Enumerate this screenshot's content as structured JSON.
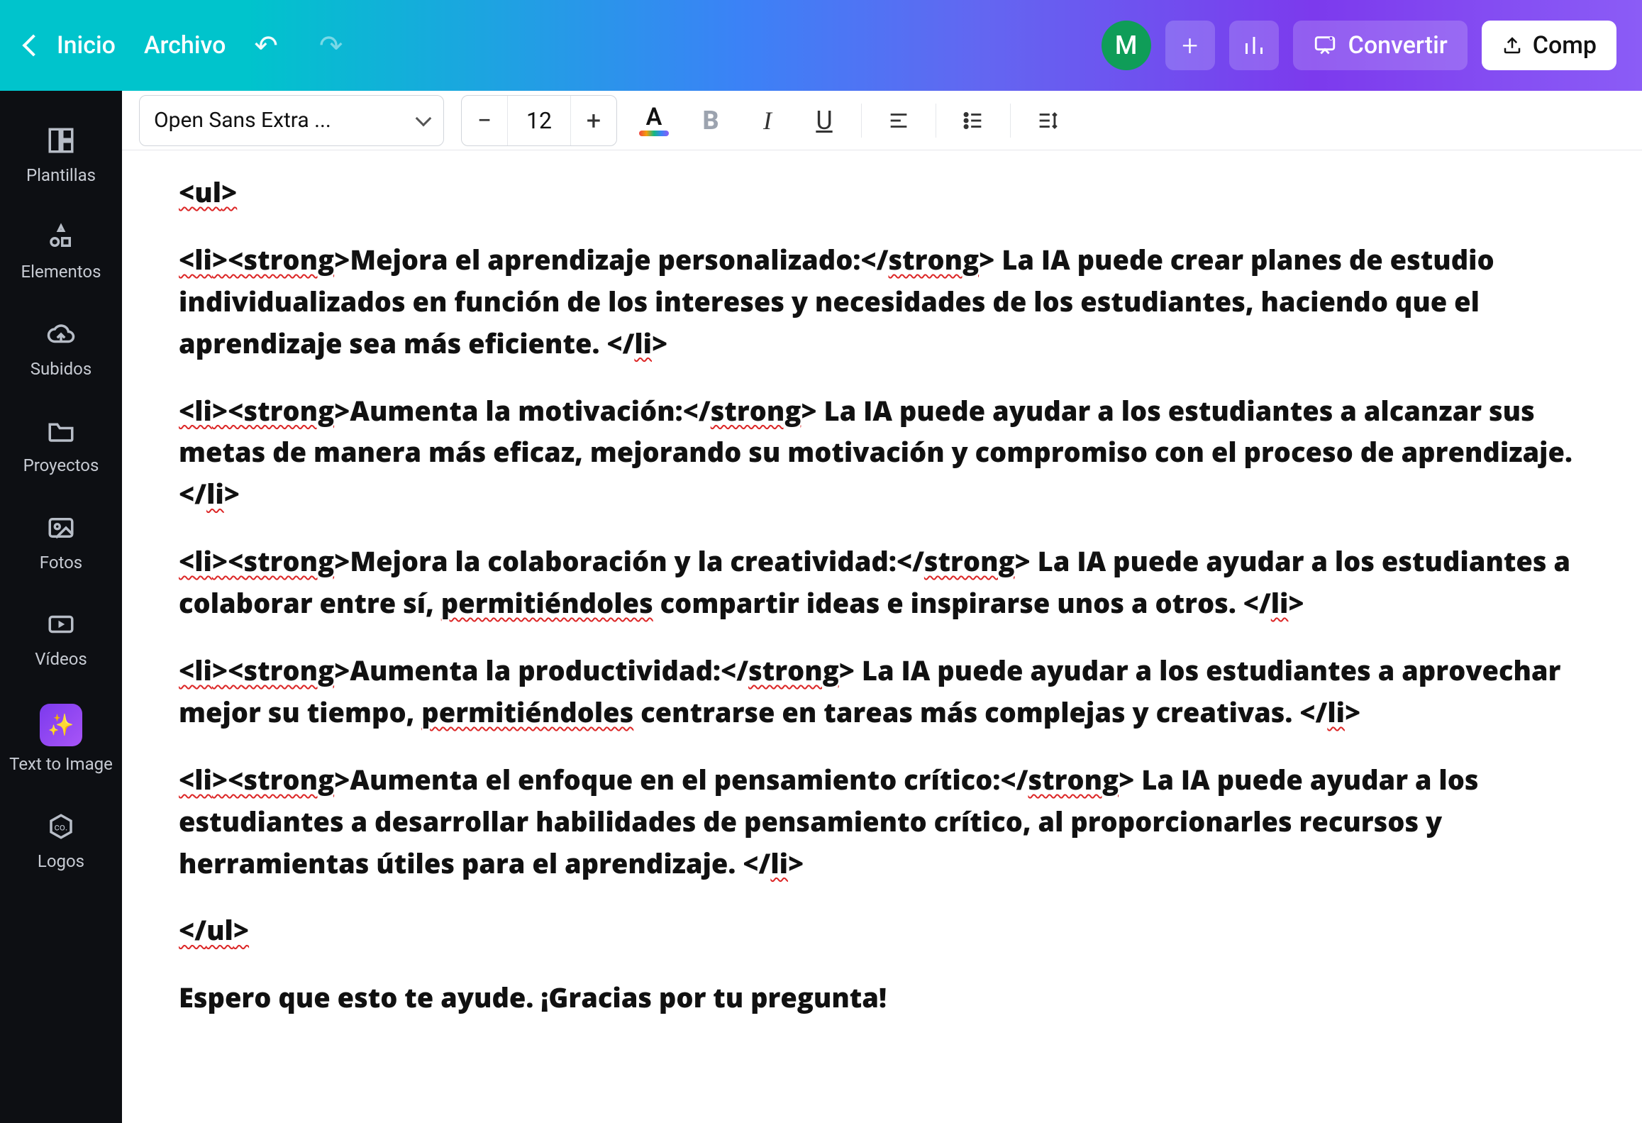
{
  "header": {
    "home_label": "Inicio",
    "file_label": "Archivo",
    "avatar_initial": "M",
    "convert_label": "Convertir",
    "share_label": "Comp"
  },
  "sidebar": {
    "items": [
      {
        "label": "Plantillas",
        "icon": "templates"
      },
      {
        "label": "Elementos",
        "icon": "elements"
      },
      {
        "label": "Subidos",
        "icon": "uploads"
      },
      {
        "label": "Proyectos",
        "icon": "projects"
      },
      {
        "label": "Fotos",
        "icon": "photos"
      },
      {
        "label": "Vídeos",
        "icon": "videos"
      },
      {
        "label": "Text to Image",
        "icon": "text-to-image"
      },
      {
        "label": "Logos",
        "icon": "logos"
      }
    ]
  },
  "toolbar": {
    "font_name": "Open Sans Extra ...",
    "font_size": "12"
  },
  "document": {
    "paragraphs": [
      {
        "runs": [
          {
            "t": "<",
            "s": true
          },
          {
            "t": "ul",
            "s": true
          },
          {
            "t": ">",
            "s": true
          }
        ]
      },
      {
        "runs": [
          {
            "t": "<",
            "s": true
          },
          {
            "t": "li",
            "s": true
          },
          {
            "t": "><",
            "s": true
          },
          {
            "t": "strong",
            "s": true
          },
          {
            "t": ">Mejora el aprendizaje personalizado:</"
          },
          {
            "t": "strong",
            "s": true
          },
          {
            "t": "> La IA puede crear planes de estudio individualizados en función de los intereses y necesidades de los estudiantes, haciendo que el aprendizaje sea más eficiente. </"
          },
          {
            "t": "li",
            "s": true
          },
          {
            "t": ">"
          }
        ]
      },
      {
        "runs": [
          {
            "t": "<",
            "s": true
          },
          {
            "t": "li",
            "s": true
          },
          {
            "t": "><",
            "s": true
          },
          {
            "t": "strong",
            "s": true
          },
          {
            "t": ">Aumenta la motivación:</"
          },
          {
            "t": "strong",
            "s": true
          },
          {
            "t": "> La IA puede ayudar a los estudiantes a alcanzar sus metas de manera más eficaz, mejorando su motivación y compromiso con el proceso de aprendizaje. </"
          },
          {
            "t": "li",
            "s": true
          },
          {
            "t": ">"
          }
        ]
      },
      {
        "runs": [
          {
            "t": "<",
            "s": true
          },
          {
            "t": "li",
            "s": true
          },
          {
            "t": "><",
            "s": true
          },
          {
            "t": "strong",
            "s": true
          },
          {
            "t": ">Mejora la colaboración y la creatividad:</"
          },
          {
            "t": "strong",
            "s": true
          },
          {
            "t": "> La IA puede ayudar a los estudiantes a colaborar entre sí, "
          },
          {
            "t": "permitiéndoles",
            "s": true
          },
          {
            "t": " compartir ideas e inspirarse unos a otros. </"
          },
          {
            "t": "li",
            "s": true
          },
          {
            "t": ">"
          }
        ]
      },
      {
        "runs": [
          {
            "t": "<",
            "s": true
          },
          {
            "t": "li",
            "s": true
          },
          {
            "t": "><",
            "s": true
          },
          {
            "t": "strong",
            "s": true
          },
          {
            "t": ">Aumenta la productividad:</"
          },
          {
            "t": "strong",
            "s": true
          },
          {
            "t": "> La IA puede ayudar a los estudiantes a aprovechar mejor su tiempo, "
          },
          {
            "t": "permitiéndoles",
            "s": true
          },
          {
            "t": " centrarse en tareas más complejas y creativas. </"
          },
          {
            "t": "li",
            "s": true
          },
          {
            "t": ">"
          }
        ]
      },
      {
        "runs": [
          {
            "t": "<",
            "s": true
          },
          {
            "t": "li",
            "s": true
          },
          {
            "t": "><",
            "s": true
          },
          {
            "t": "strong",
            "s": true
          },
          {
            "t": ">Aumenta el enfoque en el pensamiento crítico:</"
          },
          {
            "t": "strong",
            "s": true
          },
          {
            "t": "> La IA puede ayudar a los estudiantes a desarrollar habilidades de pensamiento crítico, al proporcionarles recursos y herramientas útiles para el aprendizaje. </"
          },
          {
            "t": "li",
            "s": true
          },
          {
            "t": ">"
          }
        ]
      },
      {
        "runs": [
          {
            "t": "</",
            "s": true
          },
          {
            "t": "ul",
            "s": true
          },
          {
            "t": ">",
            "s": true
          }
        ]
      },
      {
        "runs": [
          {
            "t": "Espero que esto te ayude. ¡Gracias por tu pregunta!"
          }
        ]
      }
    ]
  }
}
